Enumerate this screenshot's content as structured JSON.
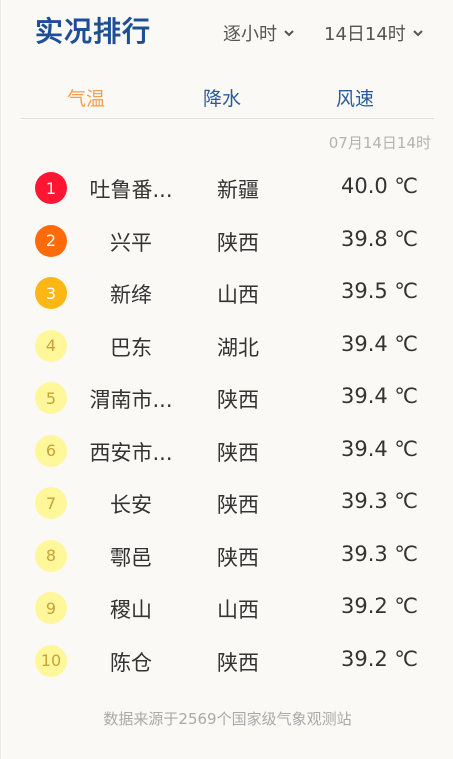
{
  "header": {
    "title": "实况排行",
    "period_label": "逐小时",
    "time_label": "14日14时"
  },
  "tabs": [
    {
      "label": "气温",
      "active": true
    },
    {
      "label": "降水",
      "active": false
    },
    {
      "label": "风速",
      "active": false
    }
  ],
  "timestamp": "07月14日14时",
  "rankings": [
    {
      "rank": "1",
      "city": "吐鲁番...",
      "province": "新疆",
      "value": "40.0 ℃"
    },
    {
      "rank": "2",
      "city": "兴平",
      "province": "陕西",
      "value": "39.8 ℃"
    },
    {
      "rank": "3",
      "city": "新绛",
      "province": "山西",
      "value": "39.5 ℃"
    },
    {
      "rank": "4",
      "city": "巴东",
      "province": "湖北",
      "value": "39.4 ℃"
    },
    {
      "rank": "5",
      "city": "渭南市...",
      "province": "陕西",
      "value": "39.4 ℃"
    },
    {
      "rank": "6",
      "city": "西安市...",
      "province": "陕西",
      "value": "39.4 ℃"
    },
    {
      "rank": "7",
      "city": "长安",
      "province": "陕西",
      "value": "39.3 ℃"
    },
    {
      "rank": "8",
      "city": "鄠邑",
      "province": "陕西",
      "value": "39.3 ℃"
    },
    {
      "rank": "9",
      "city": "稷山",
      "province": "山西",
      "value": "39.2 ℃"
    },
    {
      "rank": "10",
      "city": "陈仓",
      "province": "陕西",
      "value": "39.2 ℃"
    }
  ],
  "footer": "数据来源于2569个国家级气象观测站",
  "colors": {
    "title": "#1e4f95",
    "active_tab": "#f0a050",
    "inactive_tab": "#2b5a9c",
    "rank1": "#ff1632",
    "rank2": "#ff6a0a",
    "rank3": "#fdb714",
    "rank_other": "#fff79a"
  },
  "icons": {
    "dropdown": "chevron-down-icon"
  }
}
